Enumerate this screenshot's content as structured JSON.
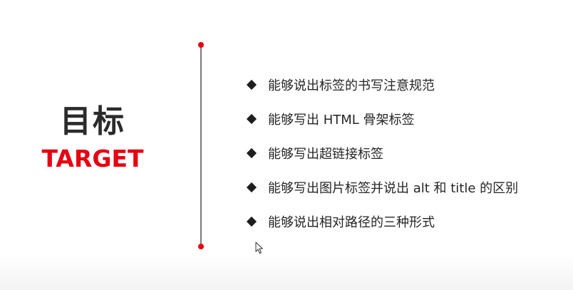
{
  "title": {
    "cn": "目标",
    "en": "TARGET"
  },
  "colors": {
    "accent": "#e60012",
    "text": "#262626",
    "divider": "#7a7a7a"
  },
  "items": [
    {
      "text": "能够说出标签的书写注意规范"
    },
    {
      "text": "能够写出 HTML 骨架标签"
    },
    {
      "text": "能够写出超链接标签"
    },
    {
      "text": "能够写出图片标签并说出 alt 和 title 的区别"
    },
    {
      "text": "能够说出相对路径的三种形式"
    }
  ],
  "bullet_icon": "diamond-bullet-icon",
  "cursor_icon": "mouse-pointer-icon"
}
